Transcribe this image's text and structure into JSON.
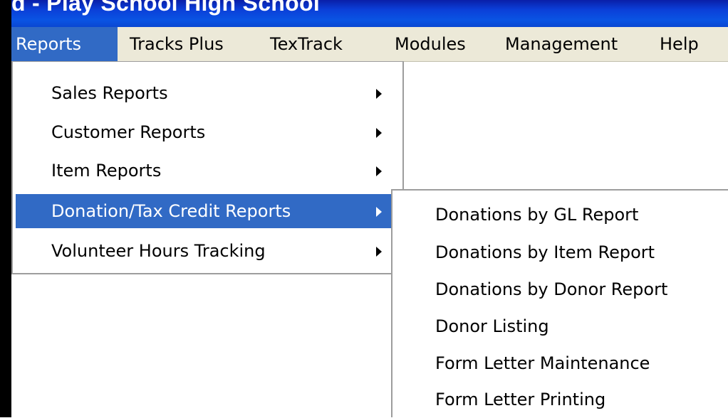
{
  "window": {
    "title": "d - Play School High School"
  },
  "menu_bar": {
    "items": [
      {
        "label": "Reports",
        "active": true
      },
      {
        "label": "Tracks Plus"
      },
      {
        "label": "TexTrack"
      },
      {
        "label": "Modules"
      },
      {
        "label": "Management"
      },
      {
        "label": "Help"
      }
    ]
  },
  "reports_menu": {
    "items": [
      {
        "label": "Sales Reports",
        "has_submenu": true
      },
      {
        "label": "Customer Reports",
        "has_submenu": true
      },
      {
        "label": "Item Reports",
        "has_submenu": true
      },
      {
        "label": "Donation/Tax Credit Reports",
        "has_submenu": true,
        "highlighted": true
      },
      {
        "label": "Volunteer Hours Tracking",
        "has_submenu": true
      }
    ]
  },
  "donation_submenu": {
    "items": [
      {
        "label": "Donations by GL Report"
      },
      {
        "label": "Donations by Item Report"
      },
      {
        "label": "Donations by Donor Report"
      },
      {
        "label": "Donor Listing"
      },
      {
        "label": "Form Letter Maintenance"
      },
      {
        "label": "Form Letter Printing"
      }
    ]
  },
  "colors": {
    "title_bar": "#0a54e3",
    "menu_bar": "#ece9d8",
    "highlight": "#316ac5"
  },
  "icons": {
    "submenu_arrow": "triangle-right"
  }
}
